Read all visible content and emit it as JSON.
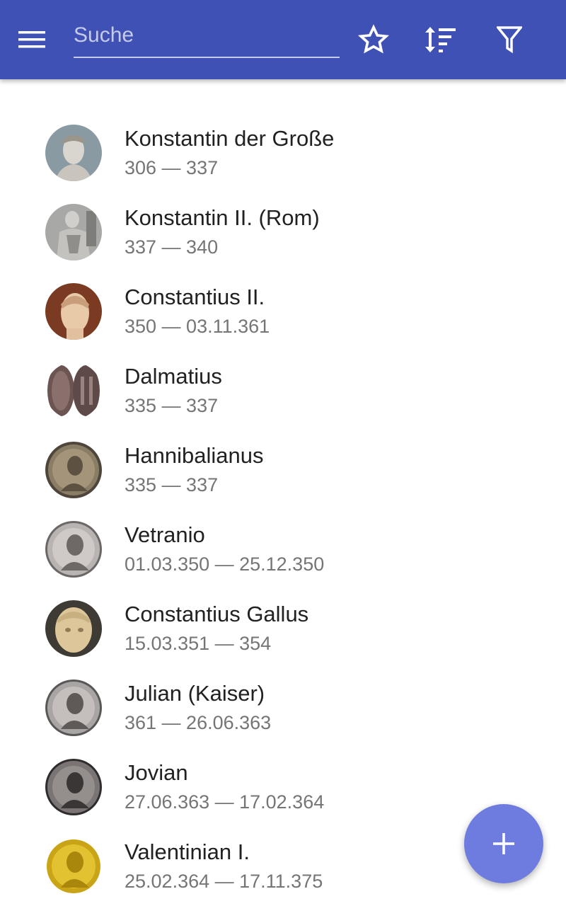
{
  "appbar": {
    "background_color": "#3f51b5",
    "menu_icon": "menu-icon",
    "search": {
      "placeholder": "Suche",
      "value": ""
    },
    "actions": [
      {
        "icon": "star-outline-icon"
      },
      {
        "icon": "sort-icon"
      },
      {
        "icon": "filter-icon"
      }
    ]
  },
  "emperors": [
    {
      "name": "Konstantin der Große",
      "reign": "306 — 337",
      "portrait": "marble-bust"
    },
    {
      "name": "Konstantin II. (Rom)",
      "reign": "337 — 340",
      "portrait": "marble-statue"
    },
    {
      "name": "Constantius II.",
      "reign": "350 — 03.11.361",
      "portrait": "marble-head"
    },
    {
      "name": "Dalmatius",
      "reign": "335 — 337",
      "portrait": "bronze-coin-pair"
    },
    {
      "name": "Hannibalianus",
      "reign": "335 — 337",
      "portrait": "bronze-coin"
    },
    {
      "name": "Vetranio",
      "reign": "01.03.350 — 25.12.350",
      "portrait": "silver-coin"
    },
    {
      "name": "Constantius Gallus",
      "reign": "15.03.351 — 354",
      "portrait": "marble-head"
    },
    {
      "name": "Julian (Kaiser)",
      "reign": "361 — 26.06.363",
      "portrait": "silver-coin"
    },
    {
      "name": "Jovian",
      "reign": "27.06.363 — 17.02.364",
      "portrait": "dark-coin"
    },
    {
      "name": "Valentinian I.",
      "reign": "25.02.364 — 17.11.375",
      "portrait": "gold-coin"
    }
  ],
  "fab": {
    "icon": "plus-icon",
    "color": "#6e7bdf"
  }
}
